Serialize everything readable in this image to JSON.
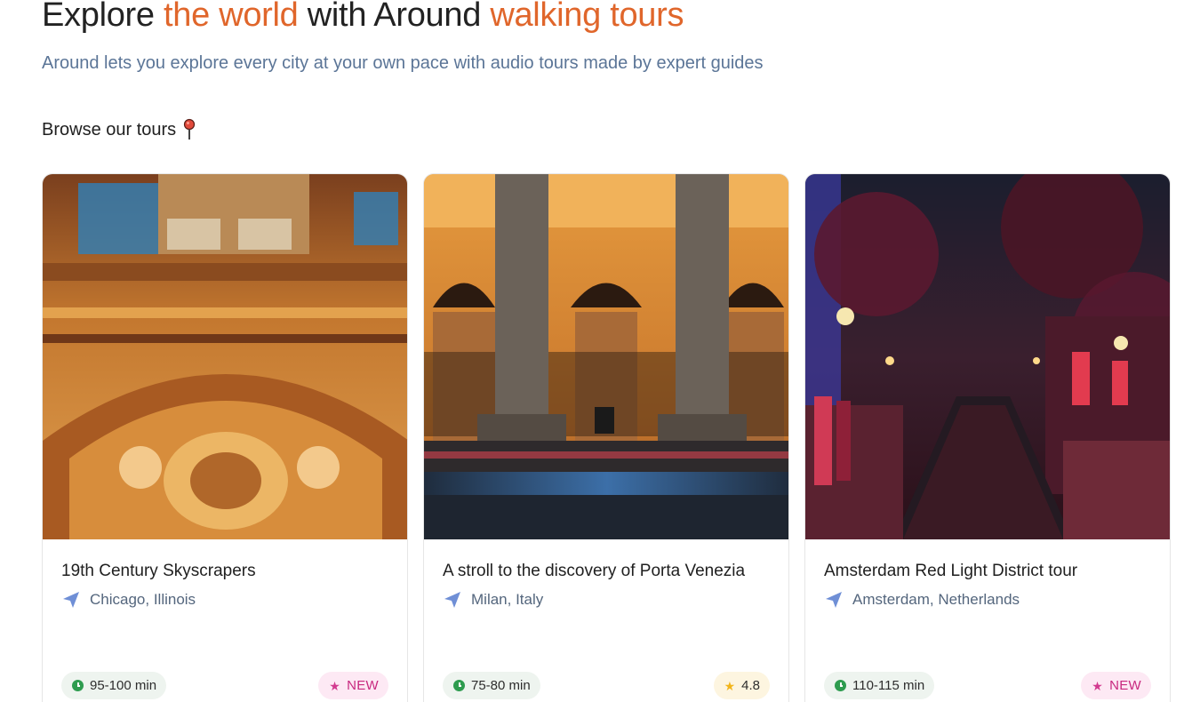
{
  "hero": {
    "title_part1": "Explore ",
    "title_accent1": "the world",
    "title_part2": " with Around ",
    "title_accent2": "walking tours",
    "subtitle": "Around lets you explore every city at your own pace with audio tours made by expert guides"
  },
  "browse": {
    "label": "Browse our tours",
    "icon": "map-pin-icon"
  },
  "colors": {
    "accent": "#e0662b",
    "subtitle": "#5b7597",
    "new_badge": "#c8297f",
    "duration_icon": "#2e9c4f",
    "rating_star": "#f2b51a"
  },
  "tours": [
    {
      "title": "19th Century Skyscrapers",
      "location": "Chicago, Illinois",
      "duration": "95-100 min",
      "badge": "NEW",
      "image": "ornate-building-facade"
    },
    {
      "title": "A stroll to the discovery of Porta Venezia",
      "location": "Milan, Italy",
      "duration": "75-80 min",
      "rating": "4.8",
      "image": "columns-night-street"
    },
    {
      "title": "Amsterdam Red Light District tour",
      "location": "Amsterdam, Netherlands",
      "duration": "110-115 min",
      "badge": "NEW",
      "image": "canal-night-lights"
    }
  ]
}
